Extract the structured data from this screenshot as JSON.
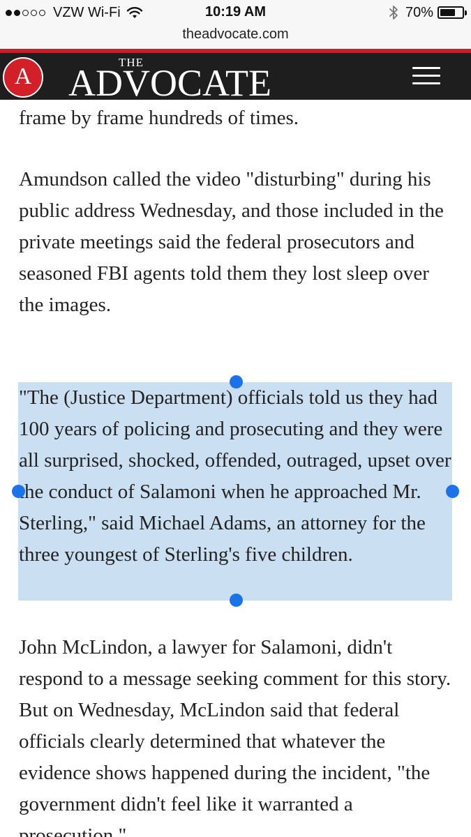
{
  "status_bar": {
    "carrier": "VZW Wi-Fi",
    "time": "10:19 AM",
    "battery_percent": "70%",
    "battery_level": 0.7,
    "signal_bars_filled": 2,
    "signal_bars_total": 5,
    "icons": [
      "wifi-icon",
      "bluetooth-icon",
      "battery-icon"
    ]
  },
  "browser": {
    "url": "theadvocate.com"
  },
  "site_header": {
    "logo_letter": "A",
    "wordmark_the": "THE",
    "wordmark": "ADVOCATE",
    "colors": {
      "accent_red": "#c8202a",
      "header_bg": "#1e1e1e",
      "logo_red": "#d21f28"
    },
    "menu_icon": "hamburger-menu-icon"
  },
  "article": {
    "paragraphs": [
      "frame by frame hundreds of times.",
      "Amundson called the video \"disturbing\" during his public address Wednesday, and those included in the private meetings said the federal prosecutors and seasoned FBI agents told them they lost sleep over the images.",
      "\"The (Justice Department) officials told us they had 100 years of policing and prosecuting and they were all surprised, shocked, offended, outraged, upset over the conduct of Salamoni when he approached Mr. Sterling,\" said Michael Adams, an attorney for the three youngest of Sterling's five children.",
      "John McLindon, a lawyer for Salamoni, didn't respond to a message seeking comment for this story. But on Wednesday, McLindon said that federal officials clearly determined that whatever the evidence shows happened during the incident, \"the government didn't feel like it warranted a prosecution.\""
    ],
    "selected_paragraph_index": 2,
    "selection_color": "#cadff1",
    "handle_color": "#1a73e8"
  }
}
